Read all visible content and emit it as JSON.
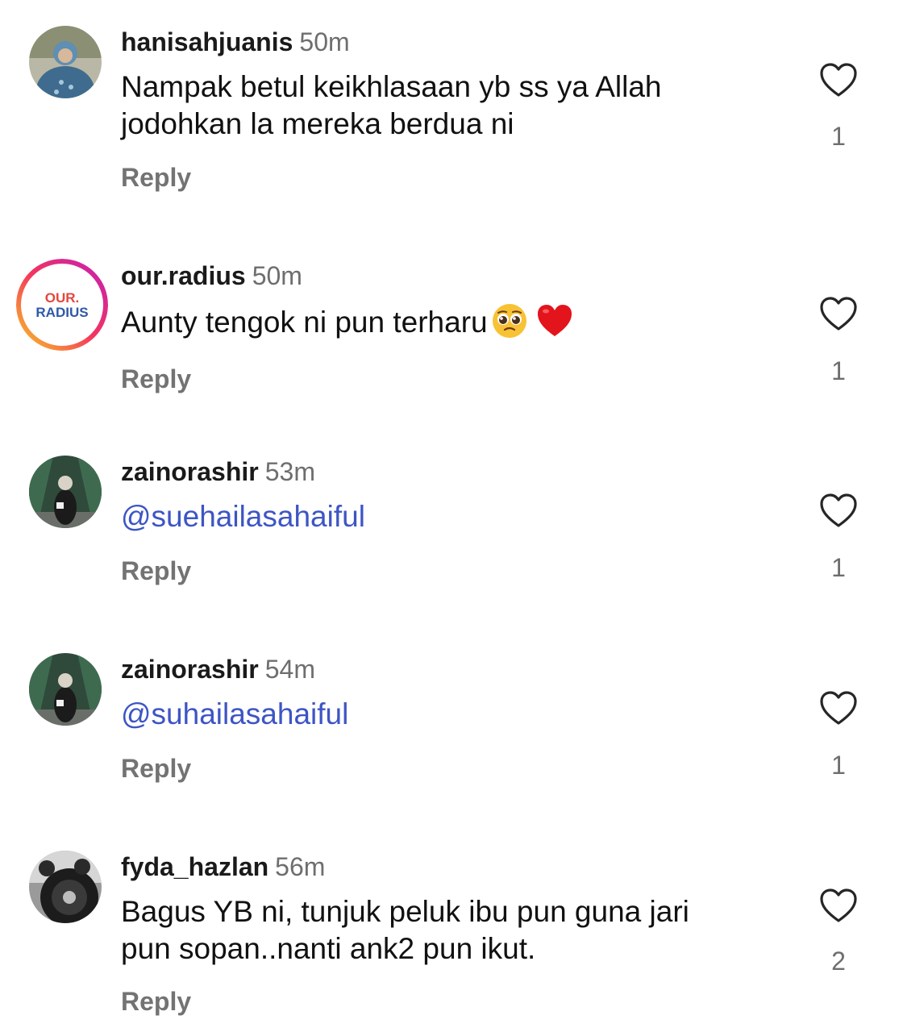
{
  "comments": [
    {
      "username": "hanisahjuanis",
      "time": "50m",
      "line1": "Nampak betul keikhlasaan yb ss ya Allah",
      "line2": "jodohkan la mereka berdua ni",
      "reply_label": "Reply",
      "likes": "1"
    },
    {
      "username": "our.radius",
      "time": "50m",
      "line1": "Aunty tengok ni pun terharu",
      "emoji": [
        "pleading-face",
        "red-heart"
      ],
      "avatar_text_top": "OUR.",
      "avatar_text_bottom": "RADIUS",
      "reply_label": "Reply",
      "likes": "1"
    },
    {
      "username": "zainorashir",
      "time": "53m",
      "line1": "@suehailasahaiful",
      "reply_label": "Reply",
      "likes": "1"
    },
    {
      "username": "zainorashir",
      "time": "54m",
      "line1": "@suhailasahaiful",
      "reply_label": "Reply",
      "likes": "1"
    },
    {
      "username": "fyda_hazlan",
      "time": "56m",
      "line1": "Bagus YB ni, tunjuk peluk ibu pun guna jari",
      "line2": "pun sopan..nanti ank2 pun ikut.",
      "reply_label": "Reply",
      "likes": "2"
    }
  ],
  "colors": {
    "mention": "#3d55c4",
    "meta_gray": "#6e6e6e",
    "reply_gray": "#737373"
  },
  "icons": {
    "like": "heart-outline-icon"
  }
}
